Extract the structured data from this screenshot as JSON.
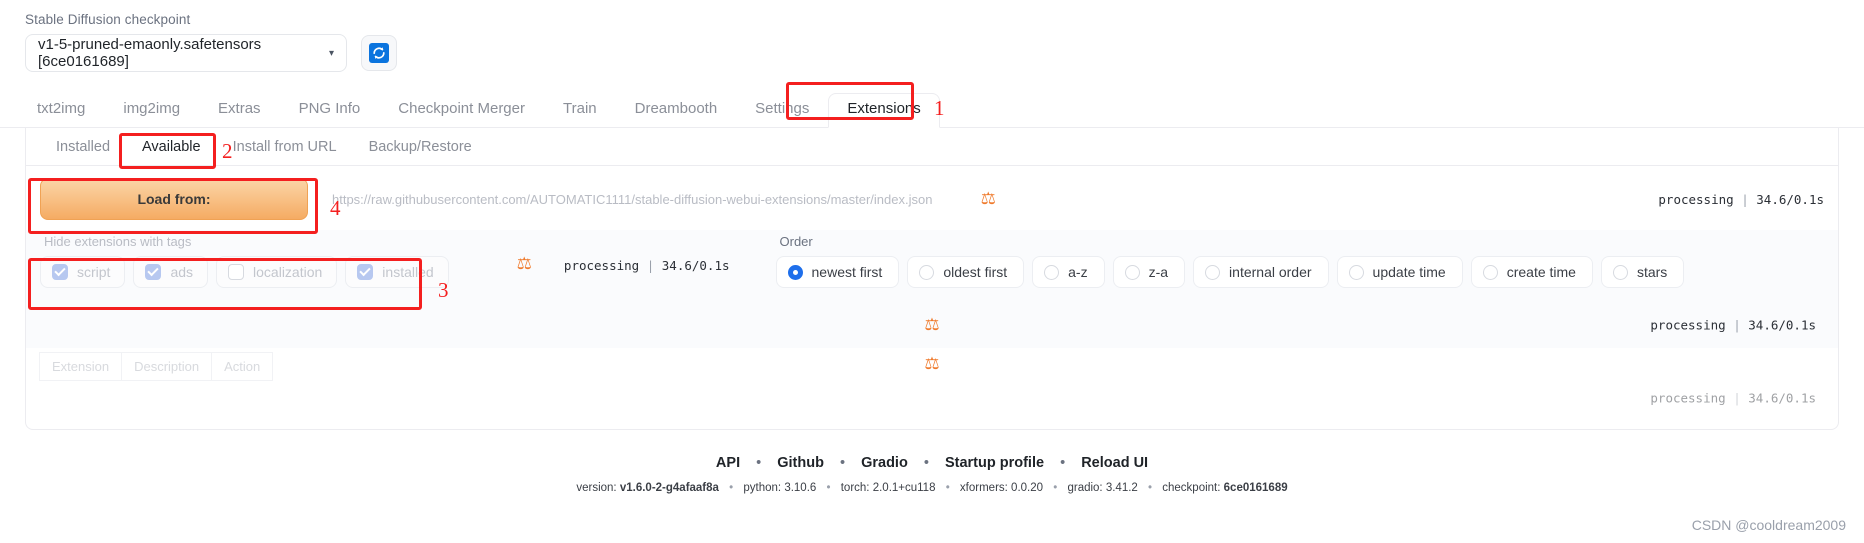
{
  "checkpoint": {
    "label": "Stable Diffusion checkpoint",
    "selected": "v1-5-pruned-emaonly.safetensors [6ce0161689]",
    "caret": "▾",
    "refresh_icon": "refresh-icon"
  },
  "main_tabs": [
    {
      "label": "txt2img",
      "selected": false
    },
    {
      "label": "img2img",
      "selected": false
    },
    {
      "label": "Extras",
      "selected": false
    },
    {
      "label": "PNG Info",
      "selected": false
    },
    {
      "label": "Checkpoint Merger",
      "selected": false
    },
    {
      "label": "Train",
      "selected": false
    },
    {
      "label": "Dreambooth",
      "selected": false
    },
    {
      "label": "Settings",
      "selected": false
    },
    {
      "label": "Extensions",
      "selected": true
    }
  ],
  "sub_tabs": [
    {
      "label": "Installed",
      "selected": false
    },
    {
      "label": "Available",
      "selected": true
    },
    {
      "label": "Install from URL",
      "selected": false
    },
    {
      "label": "Backup/Restore",
      "selected": false
    }
  ],
  "load_row": {
    "button_label": "Load from:",
    "url_value": "https://raw.githubusercontent.com/AUTOMATIC1111/stable-diffusion-webui-extensions/master/index.json",
    "squiggle_icon": "loading-squiggle-icon",
    "processing": "processing",
    "processing_sep": "|",
    "processing_time": "34.6/0.1s"
  },
  "tags_filter": {
    "label": "Hide extensions with tags",
    "items": [
      {
        "label": "script",
        "checked": true
      },
      {
        "label": "ads",
        "checked": true
      },
      {
        "label": "localization",
        "checked": false
      },
      {
        "label": "installed",
        "checked": true
      }
    ]
  },
  "order": {
    "label": "Order",
    "items": [
      {
        "label": "newest first",
        "selected": true
      },
      {
        "label": "oldest first",
        "selected": false
      },
      {
        "label": "a-z",
        "selected": false
      },
      {
        "label": "z-a",
        "selected": false
      },
      {
        "label": "internal order",
        "selected": false
      },
      {
        "label": "update time",
        "selected": false
      },
      {
        "label": "create time",
        "selected": false
      },
      {
        "label": "stars",
        "selected": false
      }
    ]
  },
  "bands": {
    "proc_row2": {
      "processing": "processing",
      "sep": "|",
      "time": "34.6/0.1s"
    },
    "proc_row3": {
      "processing": "processing",
      "sep": "|",
      "time": "34.6/0.1s"
    },
    "proc_row4": {
      "processing": "processing",
      "sep": "|",
      "time": "34.6/0.1s"
    }
  },
  "table": {
    "headers": [
      "Extension",
      "Description",
      "Action"
    ]
  },
  "footer": {
    "links": [
      "API",
      "Github",
      "Gradio",
      "Startup profile",
      "Reload UI"
    ],
    "separator": "•",
    "version_parts": [
      {
        "key": "version:",
        "val": "v1.6.0-2-g4afaaf8a"
      },
      {
        "key": "python:",
        "val": "3.10.6"
      },
      {
        "key": "torch:",
        "val": "2.0.1+cu118"
      },
      {
        "key": "xformers:",
        "val": "0.0.20"
      },
      {
        "key": "gradio:",
        "val": "3.41.2"
      },
      {
        "key": "checkpoint:",
        "val": "6ce0161689"
      }
    ]
  },
  "watermark": "CSDN @cooldream2009",
  "annotations": [
    {
      "num": "1"
    },
    {
      "num": "2"
    },
    {
      "num": "3"
    },
    {
      "num": "4"
    }
  ],
  "colors": {
    "accent_orange": "#f5ab63",
    "annotation_red": "#f41f1f",
    "radio_blue": "#1f6feb",
    "checkbox_blue": "#b7c8f0"
  }
}
